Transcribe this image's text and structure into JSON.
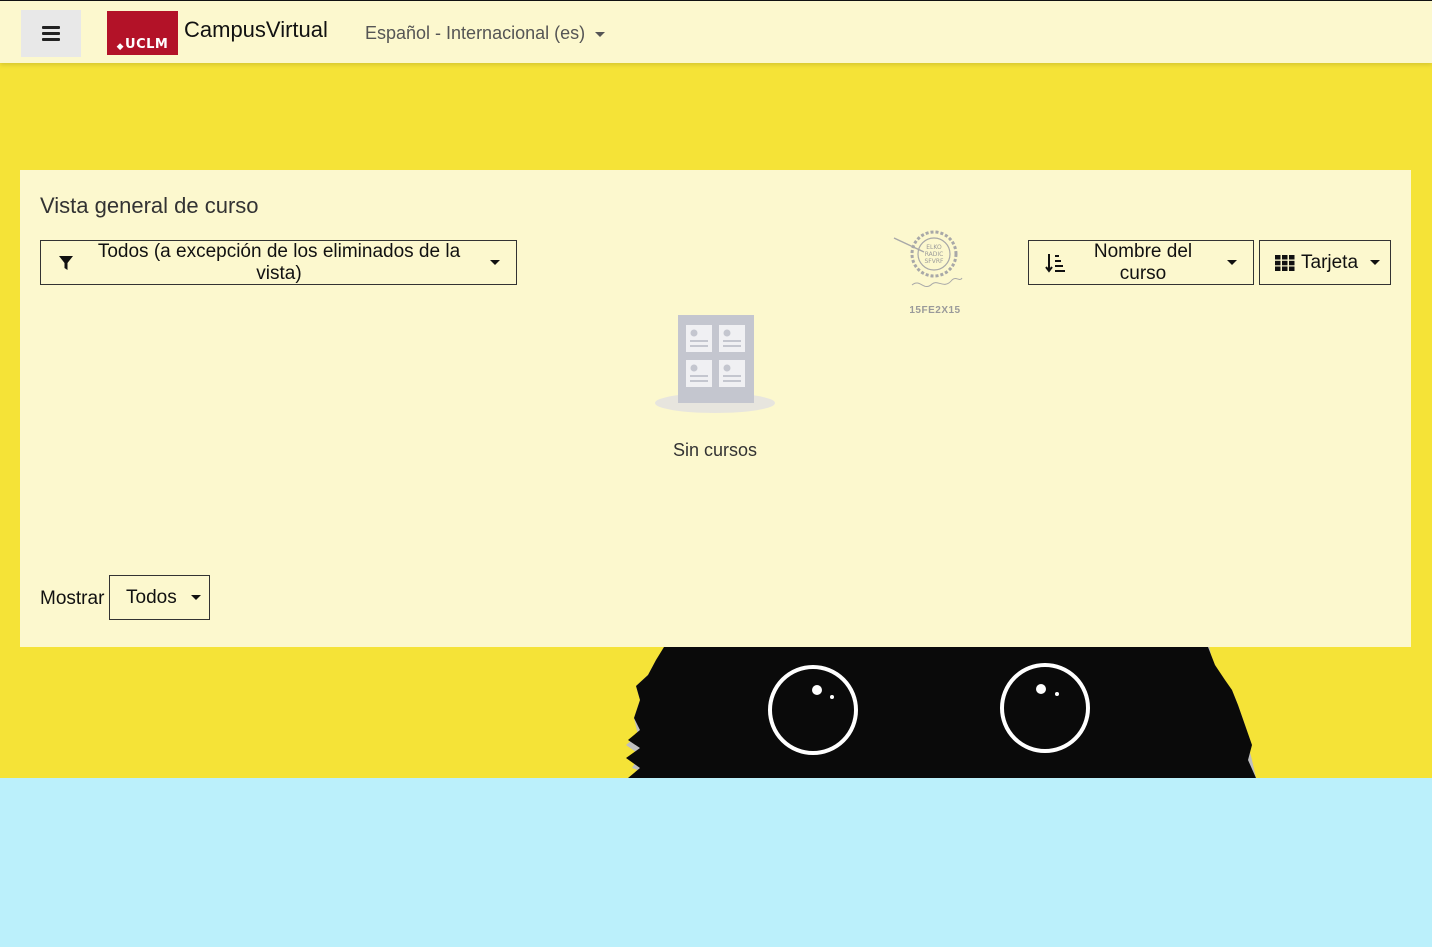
{
  "colors": {
    "page_background": "#F5E337",
    "navbar_background": "#FCF8CE",
    "card_background": "#FCF8CE",
    "bottom_band": "#BBF0FB",
    "brand_red": "#B31228"
  },
  "navbar": {
    "menu_icon": "hamburger-icon",
    "logo_text": "UCLM",
    "site_name": "CampusVirtual",
    "language": "Español - Internacional (es)"
  },
  "course_overview": {
    "title": "Vista general de curso",
    "filter_label": "Todos (a excepción de los eliminados de la vista)",
    "filter_icon": "filter-icon",
    "sort_label": "Nombre del curso",
    "sort_icon": "sort-alpha-icon",
    "view_label": "Tarjeta",
    "view_icon": "grid-icon",
    "empty_message": "Sin cursos",
    "empty_icon": "courses-placeholder-icon",
    "show_label": "Mostrar",
    "show_value": "Todos"
  },
  "stamp": {
    "code": "15FE2X15"
  }
}
